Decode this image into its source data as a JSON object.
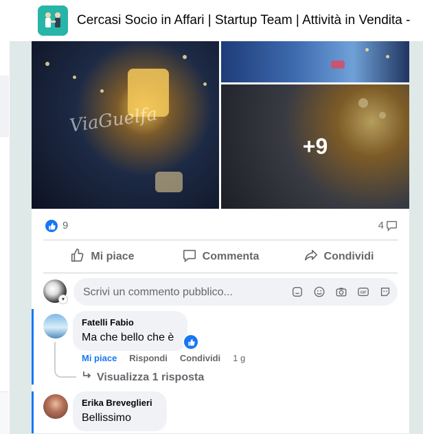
{
  "group": {
    "title": "Cercasi Socio in Affari | Startup Team | Attività in Vendita -",
    "avatar_icon": "group-logo-icon",
    "accent": "#27b5a8"
  },
  "post": {
    "photo_extra": "+9",
    "photo_script_text": "ViaGuelfa",
    "likes_count": "9",
    "comments_count": "4",
    "actions": {
      "like": "Mi piace",
      "comment": "Commenta",
      "share": "Condividi"
    }
  },
  "composer": {
    "placeholder": "Scrivi un commento pubblico...",
    "tools": [
      "sticker-icon",
      "emoji-icon",
      "camera-icon",
      "gif-icon",
      "avatar-sticker-icon"
    ]
  },
  "comments": [
    {
      "author": "Fatelli Fabio",
      "text": "Ma che bello che è",
      "like_label": "Mi piace",
      "reply_label": "Rispondi",
      "share_label": "Condividi",
      "time": "1 g",
      "view_replies": "Visualizza 1 risposta"
    },
    {
      "author": "Erika Breveglieri",
      "text": "Bellissimo"
    }
  ],
  "colors": {
    "facebook_blue": "#1877f2",
    "muted": "#65676b",
    "background": "#dfe9e8"
  }
}
